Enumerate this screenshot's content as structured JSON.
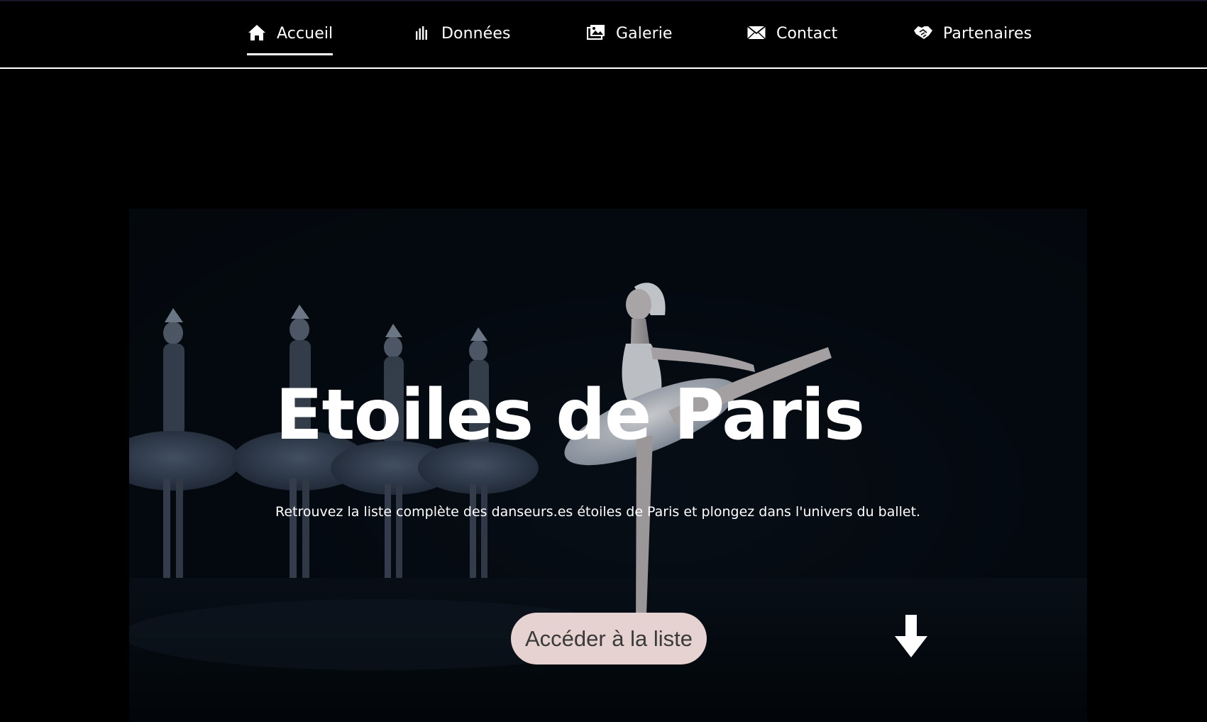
{
  "nav": {
    "items": [
      {
        "label": "Accueil",
        "icon": "home-icon",
        "active": true
      },
      {
        "label": "Données",
        "icon": "bar-chart-icon",
        "active": false
      },
      {
        "label": "Galerie",
        "icon": "gallery-image-icon",
        "active": false
      },
      {
        "label": "Contact",
        "icon": "envelope-icon",
        "active": false
      },
      {
        "label": "Partenaires",
        "icon": "handshake-icon",
        "active": false
      }
    ]
  },
  "hero": {
    "title": "Etoiles de Paris",
    "subtitle": "Retrouvez la liste complète des danseurs.es étoiles de Paris et plongez dans l'univers du ballet.",
    "cta_label": "Accéder à la liste",
    "scroll_icon": "arrow-down-icon"
  },
  "colors": {
    "background": "#000000",
    "text": "#ffffff",
    "button_bg": "#e6d2d0",
    "button_text": "#3a3a3a"
  }
}
